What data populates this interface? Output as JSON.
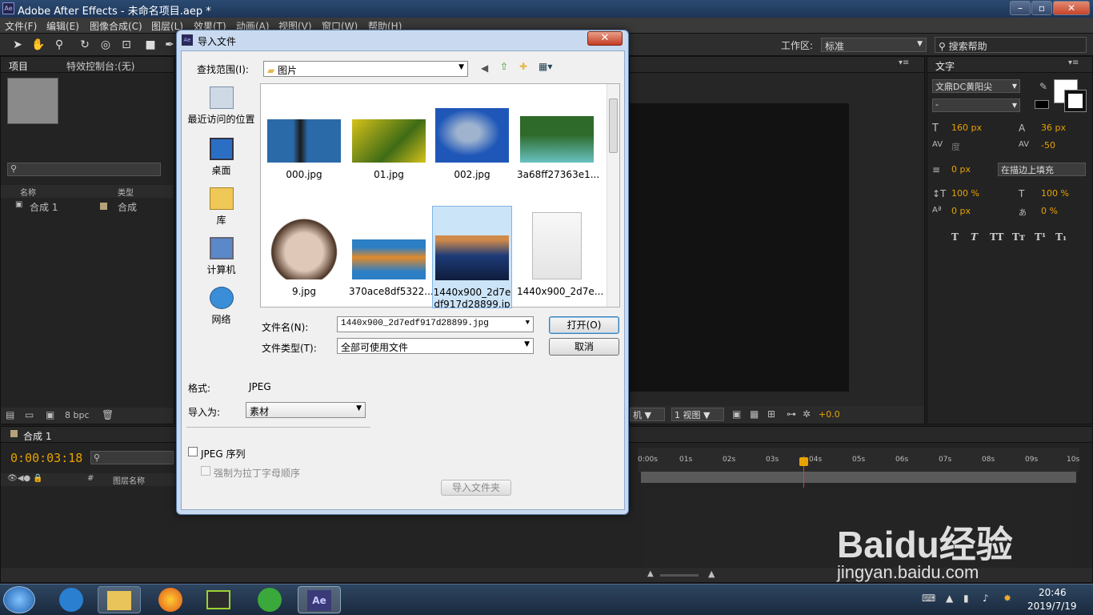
{
  "window": {
    "title": "Adobe After Effects - 未命名项目.aep *",
    "app_icon": "Ae"
  },
  "menu": [
    "文件(F)",
    "编辑(E)",
    "图像合成(C)",
    "图层(L)",
    "效果(T)",
    "动画(A)",
    "视图(V)",
    "窗口(W)",
    "帮助(H)"
  ],
  "workspace": {
    "label": "工作区:",
    "value": "标准",
    "search_placeholder": "搜索帮助"
  },
  "project_panel": {
    "tab": "项目",
    "effects_tab": "特效控制台:(无)",
    "columns": {
      "name": "名称",
      "type": "类型"
    },
    "items": [
      {
        "name": "合成 1",
        "type": "合成"
      }
    ],
    "bpc": "8 bpc"
  },
  "character_panel": {
    "tab": "文字",
    "font": "文鼎DC黄阳尖",
    "style": "-",
    "size": "160 px",
    "leading": "36 px",
    "kerning": "度",
    "tracking": "-50",
    "stroke": "0 px",
    "stroke_mode": "在描边上填充",
    "v_scale": "100 %",
    "h_scale": "100 %",
    "baseline": "0 px",
    "tsume": "0 %",
    "styles": [
      "T",
      "T",
      "TT",
      "Tт",
      "T¹",
      "T₁"
    ]
  },
  "comp_viewer": {
    "cam": "机",
    "views": "1 视图",
    "exposure": "+0.0"
  },
  "timeline": {
    "tab": "合成 1",
    "timecode": "0:00:03:18",
    "layer_col": "图层名称",
    "ticks": [
      "0:00s",
      "01s",
      "02s",
      "03s",
      "04s",
      "05s",
      "06s",
      "07s",
      "08s",
      "09s",
      "10s"
    ]
  },
  "dialog": {
    "title": "导入文件",
    "look_in_label": "查找范围(I):",
    "look_in_value": "图片",
    "places": [
      "最近访问的位置",
      "桌面",
      "库",
      "计算机",
      "网络"
    ],
    "files": [
      {
        "name": "000.jpg",
        "colors": [
          "#2b6aa8",
          "#1b1b1b"
        ]
      },
      {
        "name": "01.jpg",
        "colors": [
          "#d6c21a",
          "#3f6b16"
        ]
      },
      {
        "name": "002.jpg",
        "colors": [
          "#1f57b8",
          "#9fb3cf"
        ]
      },
      {
        "name": "3a68ff27363e1...",
        "colors": [
          "#2e6a2a",
          "#68c2c0"
        ]
      },
      {
        "name": "9.jpg",
        "colors": [
          "#d8c8b8",
          "#4a3324"
        ]
      },
      {
        "name": "370ace8df5322...",
        "colors": [
          "#e28a2a",
          "#2c7fc4"
        ]
      },
      {
        "name": "1440x900_2d7edf917d28899.jpg",
        "colors": [
          "#1d3b78",
          "#d08a4a"
        ],
        "selected": true
      },
      {
        "name": "1440x900_2d7e...",
        "colors": [
          "#f2f2f2",
          "#e0e0e0"
        ]
      }
    ],
    "filename_label": "文件名(N):",
    "filename_value": "1440x900_2d7edf917d28899.jpg",
    "filetype_label": "文件类型(T):",
    "filetype_value": "全部可使用文件",
    "open_button": "打开(O)",
    "cancel_button": "取消",
    "format_label": "格式:",
    "format_value": "JPEG",
    "import_as_label": "导入为:",
    "import_as_value": "素材",
    "sequence_label": "JPEG 序列",
    "alpha_order_label": "强制为拉丁字母顺序",
    "import_folder_button": "导入文件夹"
  },
  "taskbar": {
    "time": "20:46",
    "date": "2019/7/19"
  },
  "watermark": {
    "brand": "Baidu经验",
    "url": "jingyan.baidu.com"
  }
}
